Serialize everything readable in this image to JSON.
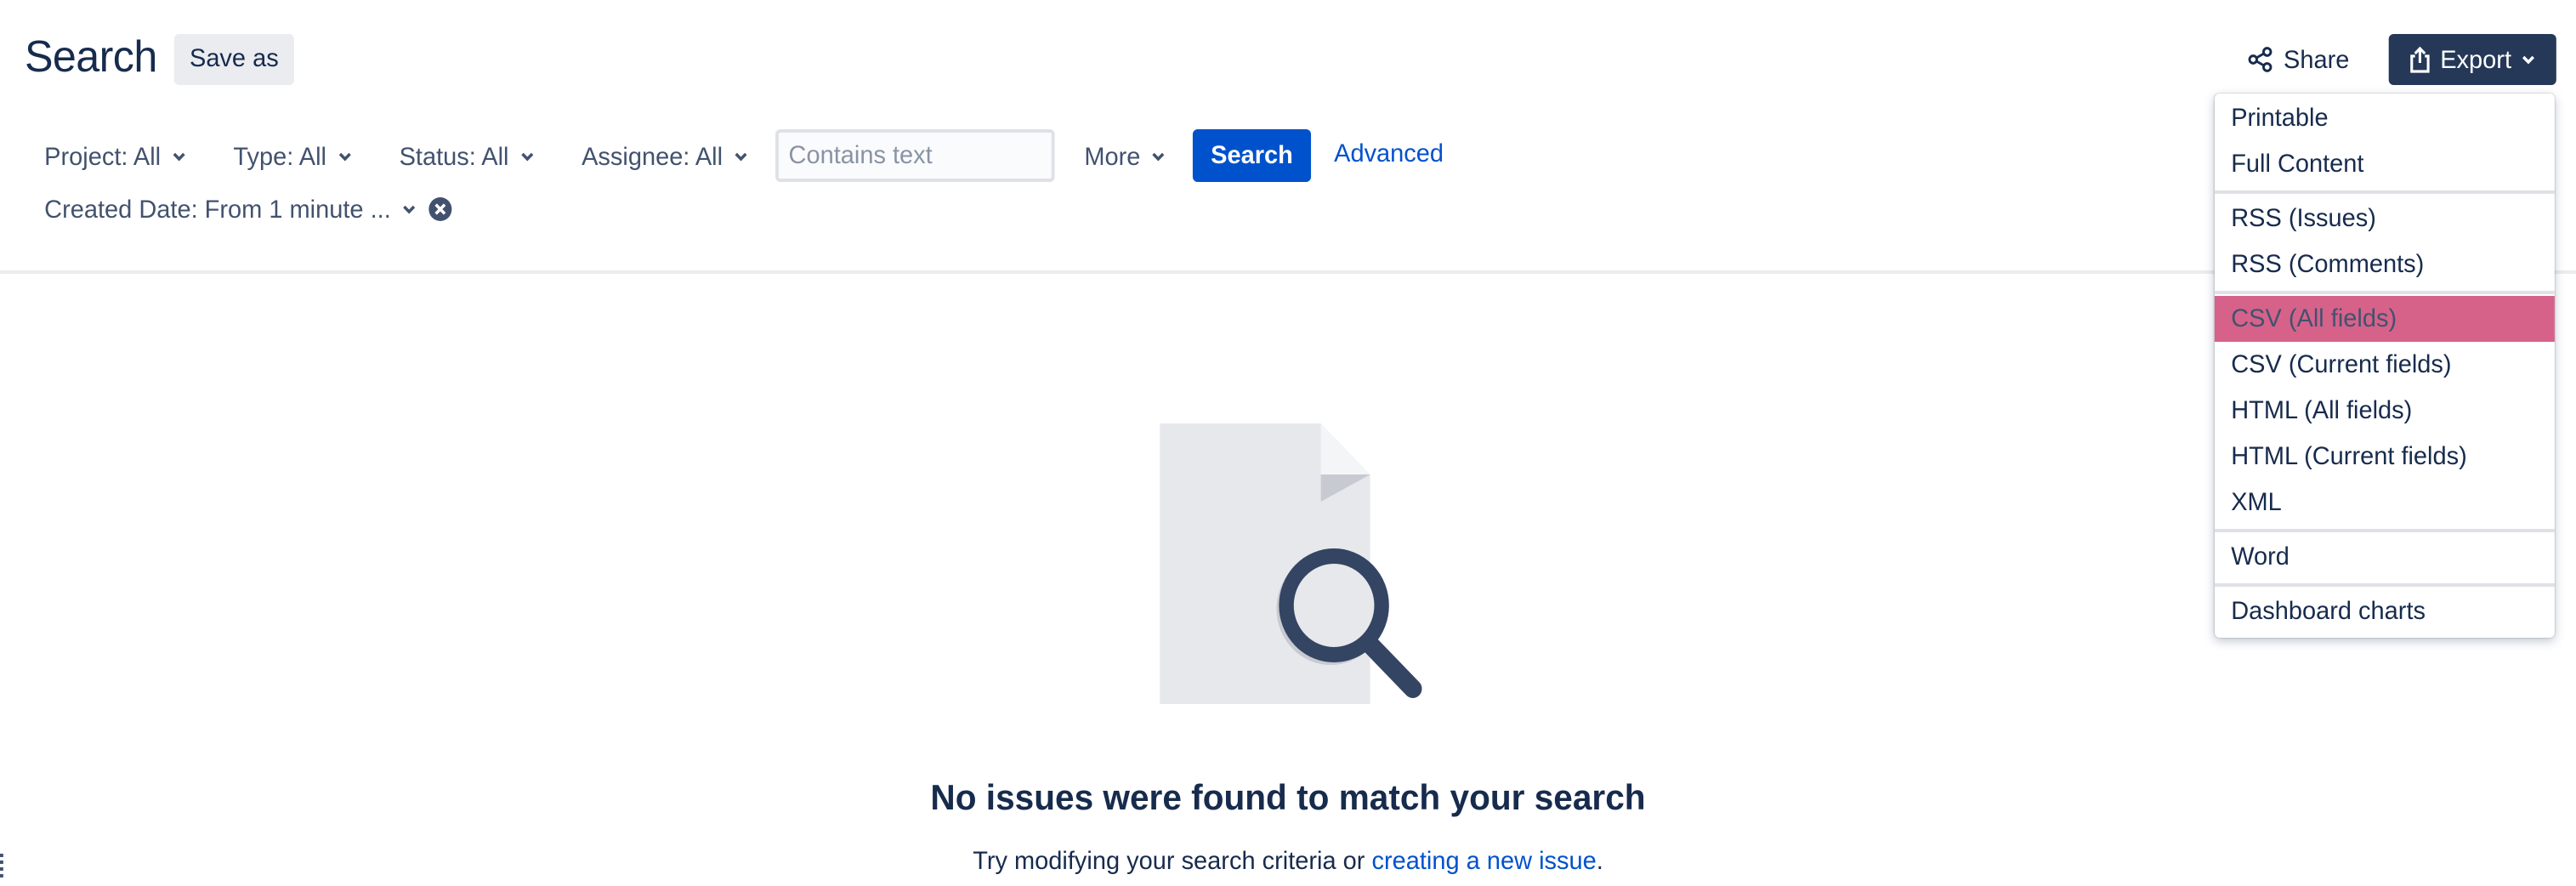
{
  "header": {
    "title": "Search",
    "save_as_label": "Save as",
    "share_label": "Share",
    "export_label": "Export"
  },
  "filters": {
    "project": "Project: All",
    "type": "Type: All",
    "status": "Status: All",
    "assignee": "Assignee: All",
    "text_placeholder": "Contains text",
    "more": "More",
    "search_button": "Search",
    "advanced": "Advanced",
    "created_date": "Created Date: From 1 minute ..."
  },
  "empty_state": {
    "title": "No issues were found to match your search",
    "subtitle_prefix": "Try modifying your search criteria or ",
    "subtitle_link": "creating a new issue",
    "subtitle_suffix": "."
  },
  "export_menu": {
    "items": [
      "Printable",
      "Full Content",
      "RSS (Issues)",
      "RSS (Comments)",
      "CSV (All fields)",
      "CSV (Current fields)",
      "HTML (All fields)",
      "HTML (Current fields)",
      "XML",
      "Word",
      "Dashboard charts"
    ],
    "highlighted": "CSV (All fields)"
  },
  "icons": {
    "share": "share-icon",
    "export": "export-icon",
    "chevron": "chevron-down-icon",
    "clear": "clear-filter-icon",
    "empty": "document-search-icon"
  },
  "colors": {
    "primary_blue": "#0052cc",
    "export_button": "#253858",
    "text_dark": "#172b4d",
    "text_muted": "#42526e",
    "menu_highlight": "#d6628a",
    "grey_button": "#ebecf0"
  }
}
